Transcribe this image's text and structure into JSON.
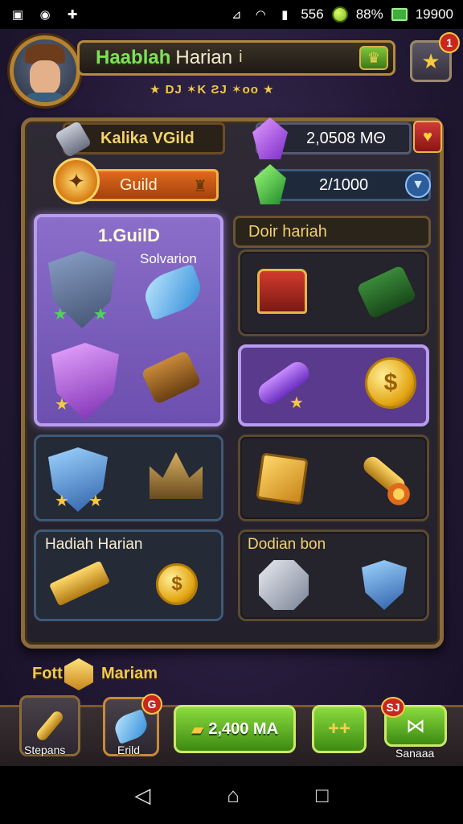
{
  "status_bar": {
    "right_text": "556",
    "battery_percent": "88%",
    "coins": "19900"
  },
  "header": {
    "title_green": "Haablah",
    "title_white": "Harian",
    "info_icon": "i",
    "rank_text": "★ DJ ✶K ƧJ ✶oo ★",
    "star_badge": "1"
  },
  "resources": {
    "guild_name": "Kalika VGild",
    "purple_amount": "2,0508 MΘ",
    "guild_label": "Guild",
    "green_amount": "2/1000"
  },
  "cells": {
    "featured_title": "1.GuilD",
    "featured_subtitle": "Solvarion",
    "daily_tab": "Doir hariah",
    "hadiah_label": "Hadiah Harian",
    "dodian_label": "Dodian bon"
  },
  "bottom": {
    "left_word": "Fott",
    "right_word": "Mariam",
    "nav1_label": "Stepans",
    "nav2_label": "Erild",
    "nav2_badge": "G",
    "nav3_amount": "2,400 MA",
    "nav4_label": "++",
    "nav5_label": "Sanaaa",
    "nav5_badge": "SJ"
  },
  "colors": {
    "accent_gold": "#f2c94c",
    "accent_green": "#7ee05a",
    "panel_border": "#8a6a3a",
    "featured_purple": "#8a6ec9"
  }
}
